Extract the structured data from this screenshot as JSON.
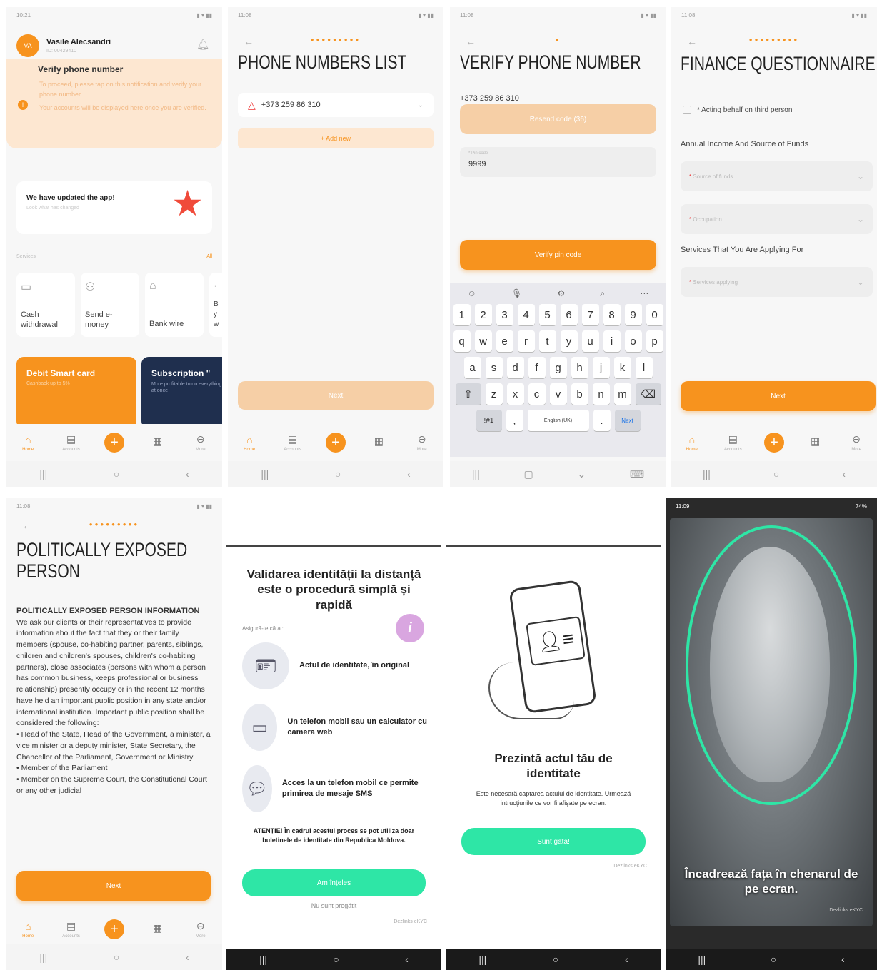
{
  "colors": {
    "accent": "#f7931e",
    "peach": "#f6cfa6",
    "green": "#2ee6a6",
    "navy": "#1f2f4e"
  },
  "status": {
    "time1": "10:21",
    "time2": "11:08",
    "time3": "11:08",
    "time4": "11:08",
    "time5": "11:08",
    "time8": "11:09",
    "battery8": "74%"
  },
  "tabs": {
    "home": "Home",
    "accounts": "Accounts",
    "more": "More"
  },
  "home": {
    "avatar": "VA",
    "user_name": "Vasile Alecsandri",
    "user_id": "ID: 00429410",
    "verify_title": "Verify phone number",
    "verify_text1": "To proceed, please tap on this notification and verify your phone number.",
    "verify_text2": "Your accounts will be displayed here once you are verified.",
    "update_title": "We have updated the app!",
    "update_sub": "Look what has changed",
    "services_label": "Services",
    "services_all": "All",
    "services": [
      {
        "label": "Cash withdrawal",
        "icon": "cash-icon"
      },
      {
        "label": "Send e-money",
        "icon": "users-icon"
      },
      {
        "label": "Bank wire",
        "icon": "bank-icon"
      },
      {
        "label": "B y w",
        "icon": "pay-icon"
      }
    ],
    "card1_title": "Debit Smart card",
    "card1_sub": "Cashback up to 5%",
    "card2_title": "Subscription \"",
    "card2_sub": "More profitable to do everything at once"
  },
  "phones": {
    "title": "PHONE NUMBERS LIST",
    "number": "+373 259 86 310",
    "add": "+ Add new",
    "next": "Next"
  },
  "verify": {
    "title": "VERIFY PHONE NUMBER",
    "number": "+373 259 86 310",
    "resend": "Resend code (36)",
    "pin_label": "* Pin code",
    "pin_value": "9999",
    "button": "Verify pin code",
    "kb_row1": [
      "1",
      "2",
      "3",
      "4",
      "5",
      "6",
      "7",
      "8",
      "9",
      "0"
    ],
    "kb_row2": [
      "q",
      "w",
      "e",
      "r",
      "t",
      "y",
      "u",
      "i",
      "o",
      "p"
    ],
    "kb_row3": [
      "a",
      "s",
      "d",
      "f",
      "g",
      "h",
      "j",
      "k",
      "l"
    ],
    "kb_row4": [
      "z",
      "x",
      "c",
      "v",
      "b",
      "n",
      "m"
    ],
    "kb_sym": "!#1",
    "kb_comma": ",",
    "kb_lang": "English (UK)",
    "kb_dot": ".",
    "kb_next": "Next"
  },
  "finance": {
    "title": "FINANCE QUESTIONNAIRE",
    "third": "* Acting behalf on third person",
    "annual": "Annual Income And Source of Funds",
    "source_ph": "Source of funds",
    "occupation_ph": "Occupation",
    "services_label": "Services That You Are Applying For",
    "services_ph": "Services applying",
    "next": "Next"
  },
  "pep": {
    "title1": "POLITICALLY EXPOSED",
    "title2": "PERSON",
    "heading": "POLITICALLY EXPOSED PERSON INFORMATION",
    "body": "We ask our clients or their representatives to provide information about the fact that they or their family members (spouse, co-habiting partner, parents, siblings, children and children's spouses, children's co-habiting partners), close associates (persons with whom a person has common business, keeps professional or business relationship) presently occupy or in the recent 12 months have held an important public position in any state and/or international institution. Important public position shall be considered the following:",
    "bullets": [
      "Head of the State, Head of the Government, a minister, a vice minister or a deputy minister, State Secretary, the Chancellor of the Parliament, Government or Ministry",
      "Member of the Parliament",
      "Member on the Supreme Court, the Constitutional Court or any other judicial"
    ],
    "next": "Next"
  },
  "ekyc1": {
    "title": "Validarea identității la distanță este o procedură simplă și rapidă",
    "ensure": "Asigură-te că ai:",
    "items": [
      {
        "text": "Actul de identitate, în original",
        "icon": "id-card-icon"
      },
      {
        "text": "Un telefon mobil sau un calculator cu camera web",
        "icon": "devices-icon"
      },
      {
        "text": "Acces la un telefon mobil ce permite primirea de mesaje SMS",
        "icon": "sms-icon"
      }
    ],
    "warning": "ATENȚIE! În cadrul acestui proces se pot utiliza doar buletinele de identitate din Republica Moldova.",
    "button": "Am înțeles",
    "not_ready": "Nu sunt pregătit",
    "brand": "Dezlinks eKYC"
  },
  "ekyc2": {
    "title": "Prezintă actul tău de identitate",
    "sub": "Este necesară captarea actului de identitate. Urmează intrucțiunile ce vor fi afișate pe ecran.",
    "button": "Sunt gata!",
    "brand": "Dezlinks eKYC"
  },
  "ekyc3": {
    "caption": "Încadrează fața în chenarul de pe ecran.",
    "brand": "Dezlinks eKYC"
  }
}
